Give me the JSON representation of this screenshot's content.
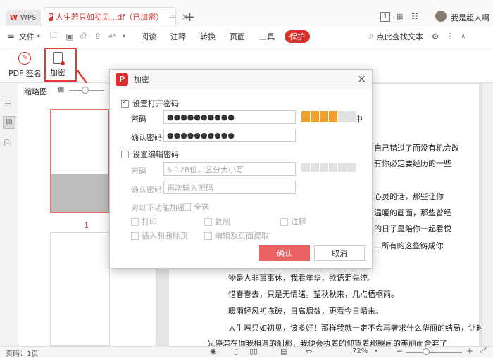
{
  "app": {
    "wps_label": "WPS",
    "doc_tab_title": "人生若只如初见...df（已加密）",
    "user_name": "我是超人啊"
  },
  "menubar": {
    "file": "文件",
    "read": "阅读",
    "annotate": "注释",
    "convert": "转换",
    "page": "页面",
    "tools": "工具",
    "protect": "保护",
    "search": "点此查找文本"
  },
  "ribbon": {
    "pdf_sign": "PDF 签名",
    "encrypt": "加密"
  },
  "thumbs": {
    "label": "缩略图",
    "page_num": "1"
  },
  "dialog": {
    "title": "加密",
    "set_open_pwd": "设置打开密码",
    "pwd_label": "密码",
    "pwd_value": "●●●●●●●●●●",
    "strength_text": "中",
    "strength_level": 4,
    "confirm_label": "确认密码",
    "confirm_value": "●●●●●●●●●●",
    "set_edit_pwd": "设置编辑密码",
    "edit_pwd_label": "密码",
    "edit_pwd_placeholder": "6-128位，区分大小写",
    "edit_confirm_label": "确认密码",
    "edit_confirm_placeholder": "再次输入密码",
    "perm_label": "对以下功能加密",
    "select_all": "全选",
    "print": "打印",
    "copy": "复制",
    "annotate": "注释",
    "insert_delete": "插入和删除页",
    "edit_extract": "编辑及页面提取",
    "ok": "确认",
    "cancel": "取消"
  },
  "document": {
    "lines": [
      "自己错过了而没有机会改",
      "有你必定要经历的一些",
      "心灵的话，那些让你",
      "温暖的画面，那些曾经",
      "的日子里陪你一起看悦",
      "...所有的这些铸成你",
      "物是人非事事休，我看年华，欲语泪先流。",
      "惜春春去，只是无情绪。望秋秋来，几点梧桐雨。",
      "暖雨轻风初冻破，日高烟敛，更看今日晴末。",
      "人生若只如初见，该多好！那样我就一定不会再奢求什么华丽的结局，让时",
      "光停滞在你我相遇的刹那，我便会执着的仰望着那瞬间的美丽而舍弃了"
    ]
  },
  "status": {
    "page_info": "页码：1页",
    "zoom": "72%"
  },
  "colors": {
    "accent": "#d9302c",
    "ok_button": "#ec6262",
    "strength": "#f0a030",
    "highlight_box": "#e53935"
  }
}
